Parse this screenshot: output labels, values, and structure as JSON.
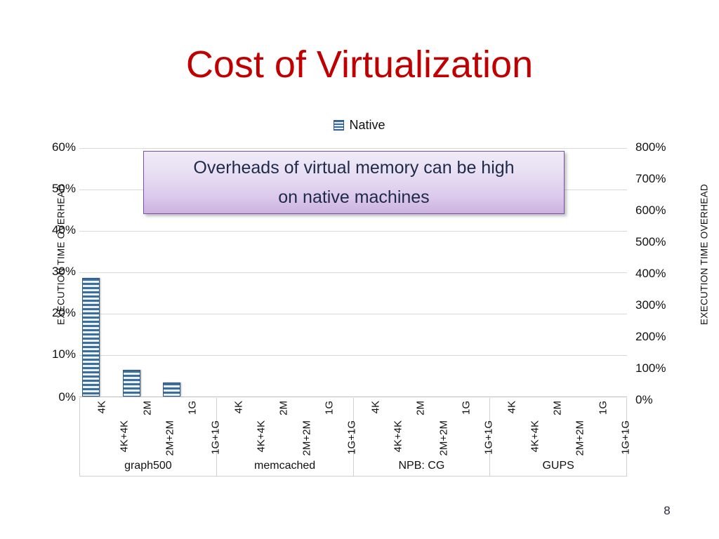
{
  "slide": {
    "title": "Cost of Virtualization",
    "title_color": "#C00000",
    "page_number": "8"
  },
  "callout": {
    "text": "Overheads of virtual memory can be high\non native machines",
    "border_color": "#7B4FA8",
    "fill_top": "#EFEAF7",
    "fill_bottom": "#CBB2E0"
  },
  "legend": {
    "position": "top-center",
    "entries": [
      {
        "label": "Native",
        "swatch": "horizontal-stripes-blue",
        "color": "#3D6E9B"
      }
    ]
  },
  "axes": {
    "left": {
      "title": "EXECUTION TIME OVERHEAD",
      "ticks": [
        "0%",
        "10%",
        "20%",
        "30%",
        "40%",
        "50%",
        "60%"
      ]
    },
    "right": {
      "title": "EXECUTION TIME OVERHEAD",
      "ticks": [
        "0%",
        "100%",
        "200%",
        "300%",
        "400%",
        "500%",
        "600%",
        "700%",
        "800%"
      ]
    }
  },
  "chart_data": {
    "type": "bar",
    "title": "",
    "xlabel": "",
    "ylabel": "EXECUTION TIME OVERHEAD",
    "ylim": [
      0,
      60
    ],
    "ylim_secondary": [
      0,
      800
    ],
    "grid": true,
    "legend_position": "top-center",
    "groups": [
      "graph500",
      "memcached",
      "NPB: CG",
      "GUPS"
    ],
    "categories": [
      "4K",
      "4K+4K",
      "2M",
      "2M+2M",
      "1G",
      "1G+1G"
    ],
    "series": [
      {
        "name": "Native",
        "axis": "left",
        "values": [
          [
            28.6,
            null,
            6.3,
            null,
            3.2,
            null
          ],
          [
            null,
            null,
            null,
            null,
            null,
            null
          ],
          [
            null,
            null,
            null,
            null,
            null,
            null
          ],
          [
            null,
            null,
            null,
            null,
            null,
            null
          ]
        ]
      }
    ]
  }
}
